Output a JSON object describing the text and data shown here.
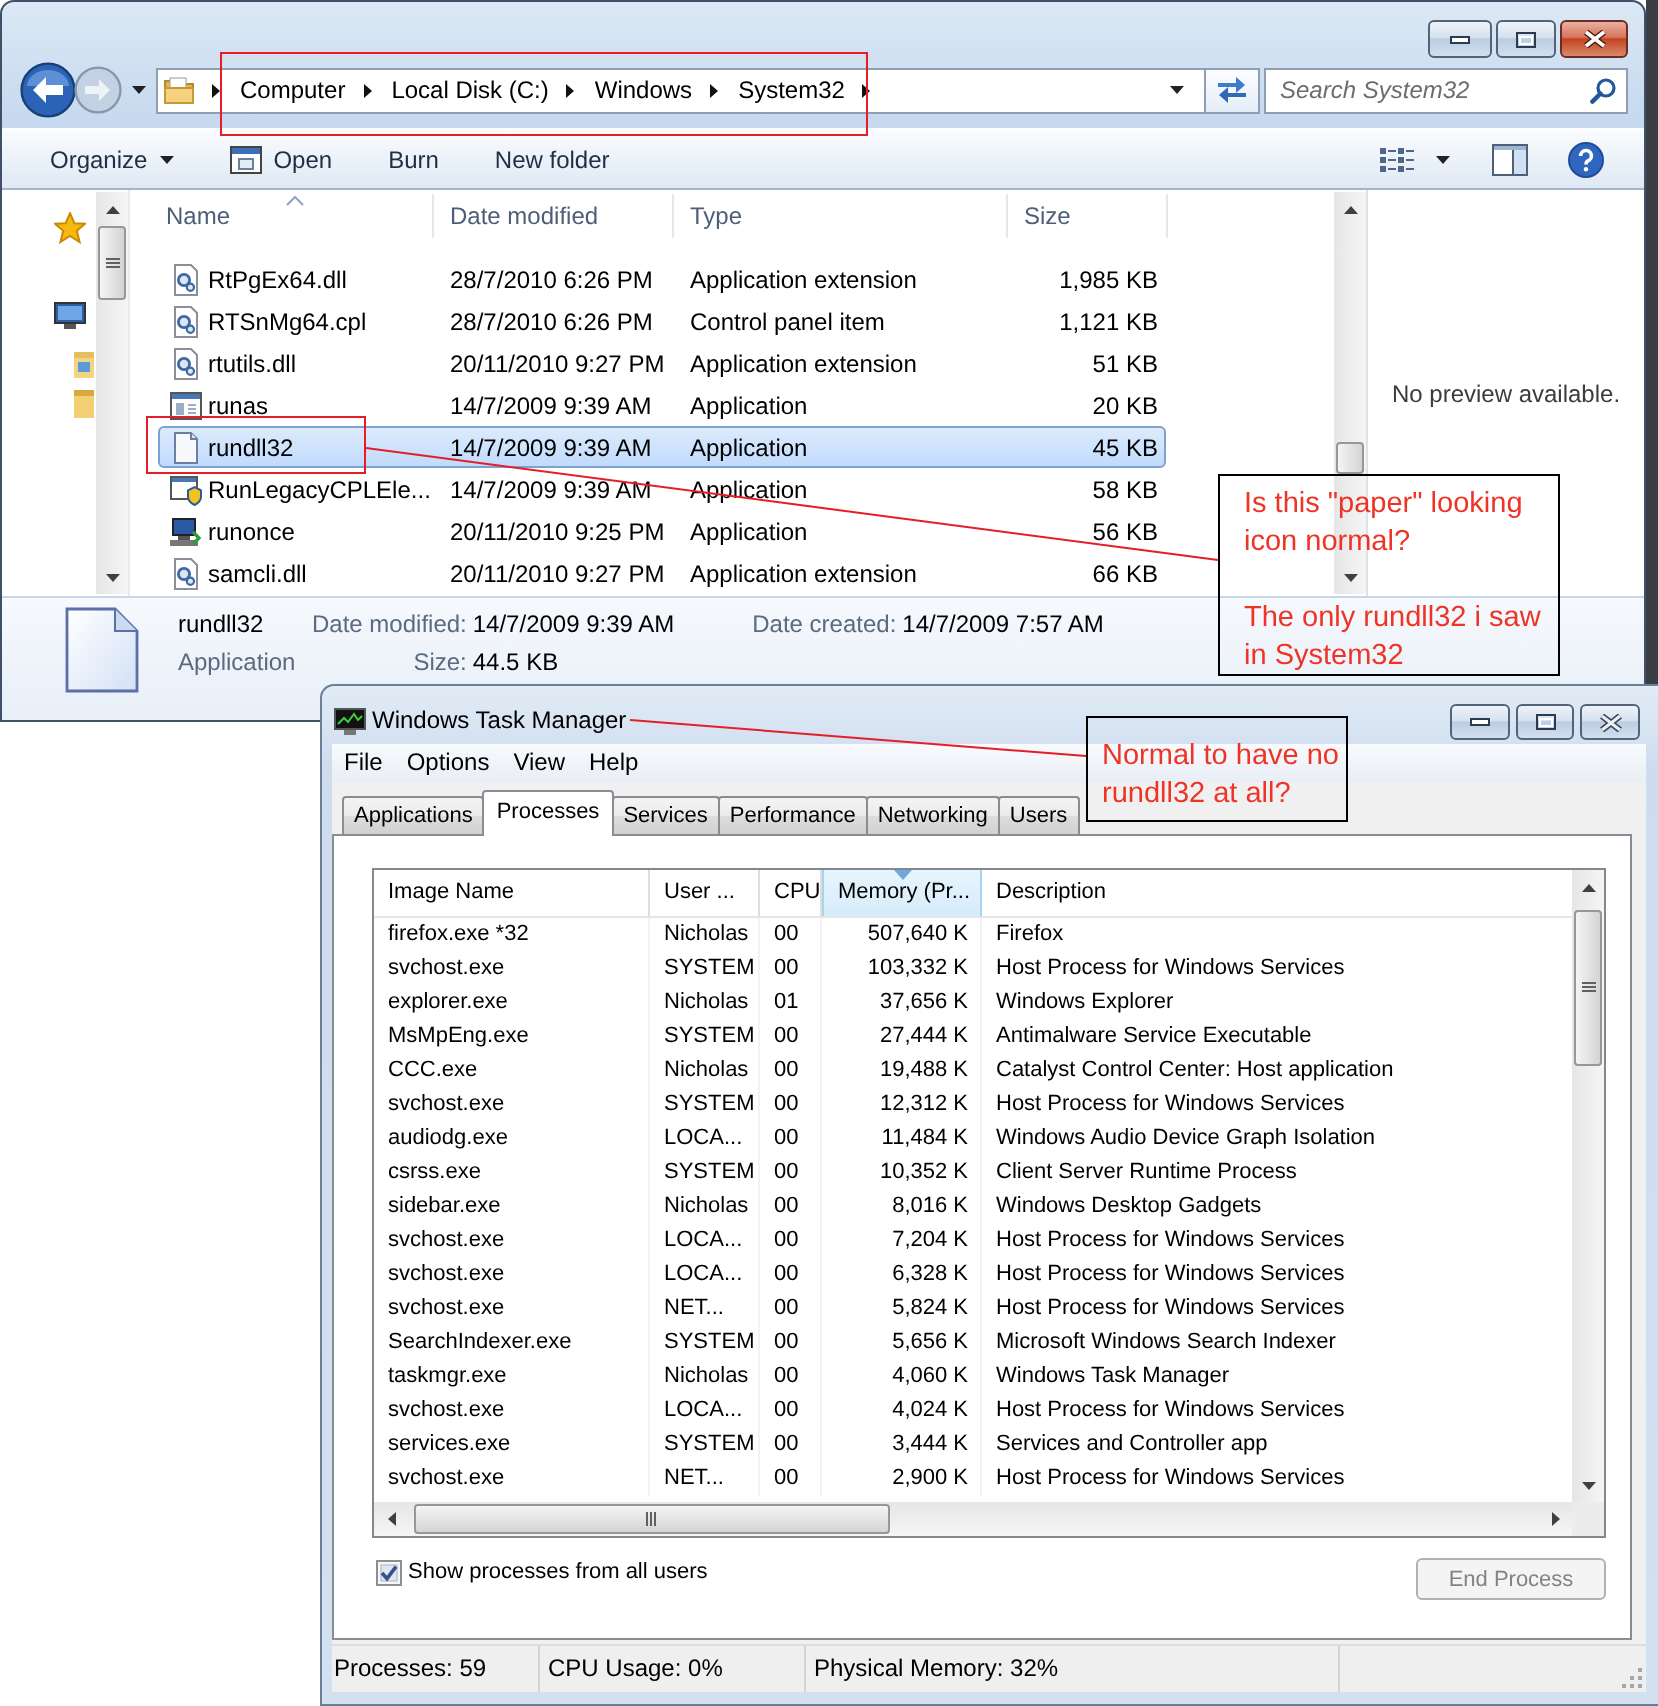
{
  "explorer": {
    "active": true,
    "address": {
      "crumbs": [
        "Computer",
        "Local Disk (C:)",
        "Windows",
        "System32"
      ],
      "highlighted": true
    },
    "search": {
      "placeholder": "Search System32"
    },
    "commands": [
      {
        "label": "Organize",
        "kind": "menu"
      },
      {
        "label": "Open",
        "kind": "open"
      },
      {
        "label": "Burn",
        "kind": "plain"
      },
      {
        "label": "New folder",
        "kind": "plain"
      }
    ],
    "columns": [
      {
        "label": "Name",
        "kind": "text",
        "sorted": true
      },
      {
        "label": "Date modified",
        "kind": "text",
        "sorted": false
      },
      {
        "label": "Type",
        "kind": "text",
        "sorted": false
      },
      {
        "label": "Size",
        "kind": "number",
        "sorted": false
      }
    ],
    "files": [
      {
        "name": "RtPgEx64.dll",
        "date_modified": "28/7/2010 6:26 PM",
        "type": "Application extension",
        "size": "1,985 KB",
        "kind": "extension",
        "selected": false,
        "highlighted": false
      },
      {
        "name": "RTSnMg64.cpl",
        "date_modified": "28/7/2010 6:26 PM",
        "type": "Control panel item",
        "size": "1,121 KB",
        "kind": "extension",
        "selected": false,
        "highlighted": false
      },
      {
        "name": "rtutils.dll",
        "date_modified": "20/11/2010 9:27 PM",
        "type": "Application extension",
        "size": "51 KB",
        "kind": "extension",
        "selected": false,
        "highlighted": false
      },
      {
        "name": "runas",
        "date_modified": "14/7/2009 9:39 AM",
        "type": "Application",
        "size": "20 KB",
        "kind": "window",
        "selected": false,
        "highlighted": false
      },
      {
        "name": "rundll32",
        "date_modified": "14/7/2009 9:39 AM",
        "type": "Application",
        "size": "45 KB",
        "kind": "blank",
        "selected": true,
        "highlighted": true
      },
      {
        "name": "RunLegacyCPLEle...",
        "date_modified": "14/7/2009 9:39 AM",
        "type": "Application",
        "size": "58 KB",
        "kind": "shield",
        "selected": false,
        "highlighted": false
      },
      {
        "name": "runonce",
        "date_modified": "20/11/2010 9:25 PM",
        "type": "Application",
        "size": "56 KB",
        "kind": "setup",
        "selected": false,
        "highlighted": false
      },
      {
        "name": "samcli.dll",
        "date_modified": "20/11/2010 9:27 PM",
        "type": "Application extension",
        "size": "66 KB",
        "kind": "extension",
        "selected": false,
        "highlighted": false
      }
    ],
    "preview": {
      "message": "No preview available."
    },
    "details": {
      "name": "rundll32",
      "type": "Application",
      "fields": [
        {
          "label": "Date modified:",
          "value": "14/7/2009 9:39 AM"
        },
        {
          "label": "Date created:",
          "value": "14/7/2009 7:57 AM"
        },
        {
          "label": "Size:",
          "value": "44.5 KB"
        }
      ]
    }
  },
  "task_manager": {
    "active": false,
    "title": "Windows Task Manager",
    "menu": [
      "File",
      "Options",
      "View",
      "Help"
    ],
    "tabs": [
      {
        "label": "Applications",
        "selected": false
      },
      {
        "label": "Processes",
        "selected": true
      },
      {
        "label": "Services",
        "selected": false
      },
      {
        "label": "Performance",
        "selected": false
      },
      {
        "label": "Networking",
        "selected": false
      },
      {
        "label": "Users",
        "selected": false
      }
    ],
    "columns": [
      {
        "label": "Image Name",
        "kind": "text",
        "sorted": false
      },
      {
        "label": "User ...",
        "kind": "text",
        "sorted": false
      },
      {
        "label": "CPU",
        "kind": "text",
        "sorted": false
      },
      {
        "label": "Memory (Pr...",
        "kind": "number",
        "sorted": true
      },
      {
        "label": "Description",
        "kind": "text",
        "sorted": false
      }
    ],
    "rows": [
      [
        "firefox.exe *32",
        "Nicholas",
        "00",
        "507,640 K",
        "Firefox"
      ],
      [
        "svchost.exe",
        "SYSTEM",
        "00",
        "103,332 K",
        "Host Process for Windows Services"
      ],
      [
        "explorer.exe",
        "Nicholas",
        "01",
        "37,656 K",
        "Windows Explorer"
      ],
      [
        "MsMpEng.exe",
        "SYSTEM",
        "00",
        "27,444 K",
        "Antimalware Service Executable"
      ],
      [
        "CCC.exe",
        "Nicholas",
        "00",
        "19,488 K",
        "Catalyst Control Center: Host application"
      ],
      [
        "svchost.exe",
        "SYSTEM",
        "00",
        "12,312 K",
        "Host Process for Windows Services"
      ],
      [
        "audiodg.exe",
        "LOCA...",
        "00",
        "11,484 K",
        "Windows Audio Device Graph Isolation"
      ],
      [
        "csrss.exe",
        "SYSTEM",
        "00",
        "10,352 K",
        "Client Server Runtime Process"
      ],
      [
        "sidebar.exe",
        "Nicholas",
        "00",
        "8,016 K",
        "Windows Desktop Gadgets"
      ],
      [
        "svchost.exe",
        "LOCA...",
        "00",
        "7,204 K",
        "Host Process for Windows Services"
      ],
      [
        "svchost.exe",
        "LOCA...",
        "00",
        "6,328 K",
        "Host Process for Windows Services"
      ],
      [
        "svchost.exe",
        "NET...",
        "00",
        "5,824 K",
        "Host Process for Windows Services"
      ],
      [
        "SearchIndexer.exe",
        "SYSTEM",
        "00",
        "5,656 K",
        "Microsoft Windows Search Indexer"
      ],
      [
        "taskmgr.exe",
        "Nicholas",
        "00",
        "4,060 K",
        "Windows Task Manager"
      ],
      [
        "svchost.exe",
        "LOCA...",
        "00",
        "4,024 K",
        "Host Process for Windows Services"
      ],
      [
        "services.exe",
        "SYSTEM",
        "00",
        "3,444 K",
        "Services and Controller app"
      ],
      [
        "svchost.exe",
        "NET...",
        "00",
        "2,900 K",
        "Host Process for Windows Services"
      ]
    ],
    "show_all_users": {
      "label": "Show processes from all users",
      "checked": true
    },
    "end_button": {
      "label": "End Process",
      "disabled": true
    },
    "status_bar": [
      "Processes: 59",
      "CPU Usage: 0%",
      "Physical Memory: 32%"
    ]
  },
  "annotations": [
    {
      "paragraphs": [
        "Is this \"paper\" looking icon normal?",
        "The only rundll32 i saw in System32"
      ]
    },
    {
      "paragraphs": [
        "Normal to have no rundll32 at all?"
      ]
    }
  ]
}
